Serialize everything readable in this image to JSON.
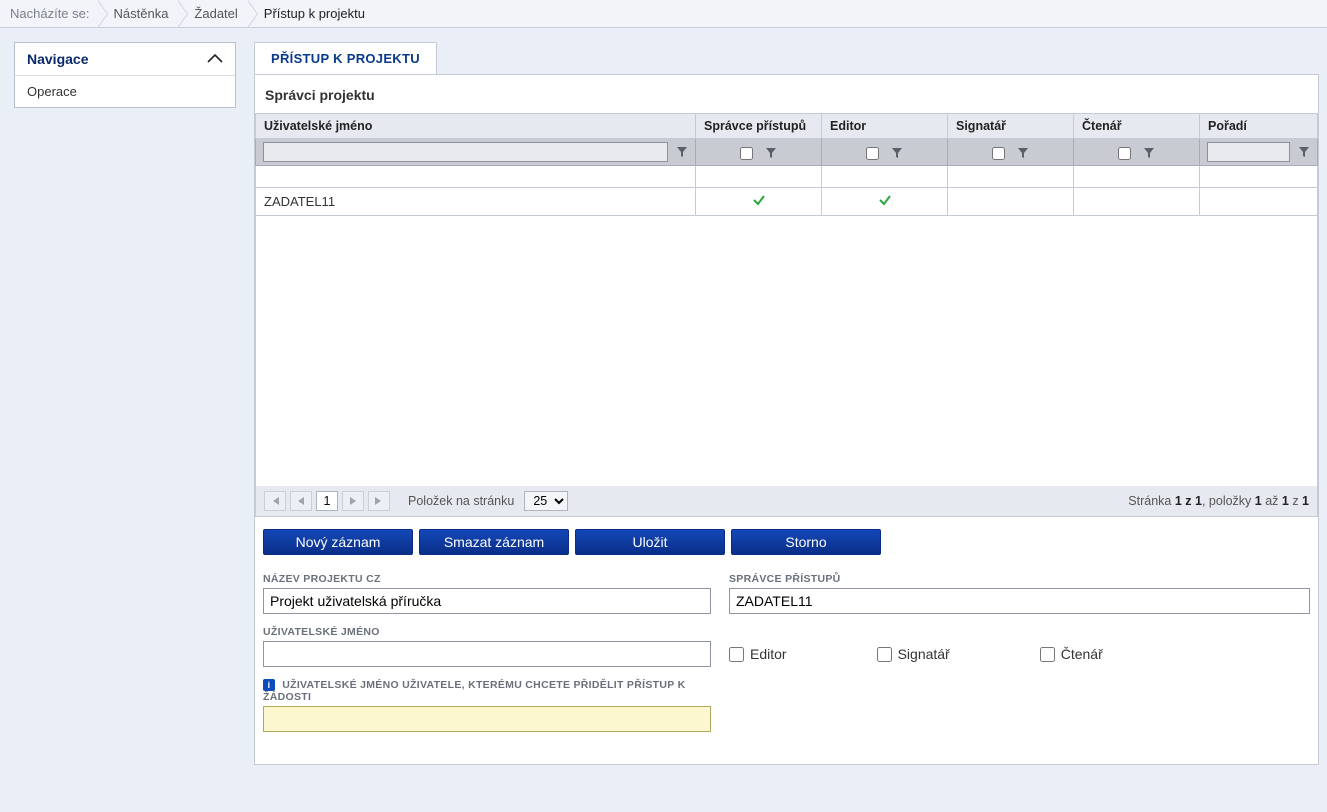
{
  "breadcrumb": {
    "label": "Nacházíte se:",
    "items": [
      "Nástěnka",
      "Žadatel",
      "Přístup k projektu"
    ]
  },
  "sidebar": {
    "nav_title": "Navigace",
    "items": [
      "Operace"
    ]
  },
  "tab": {
    "title": "PŘÍSTUP K PROJEKTU"
  },
  "grid": {
    "title": "Správci projektu",
    "columns": {
      "username": "Uživatelské jméno",
      "access_admin": "Správce přístupů",
      "editor": "Editor",
      "signatory": "Signatář",
      "reader": "Čtenář",
      "order": "Pořadí"
    },
    "rows": [
      {
        "username": "ZADATEL11",
        "access_admin": true,
        "editor": true,
        "signatory": false,
        "reader": false,
        "order": ""
      }
    ]
  },
  "pager": {
    "page": "1",
    "per_page_label": "Položek na stránku",
    "per_page_value": "25",
    "info_prefix": "Stránka ",
    "info_page": "1 z 1",
    "info_mid": ", položky ",
    "info_items_from": "1",
    "info_items_mid": " až ",
    "info_items_to": "1",
    "info_items_of": " z ",
    "info_items_total": "1"
  },
  "actions": {
    "new": "Nový záznam",
    "delete": "Smazat záznam",
    "save": "Uložit",
    "cancel": "Storno"
  },
  "form": {
    "project_name_label": "NÁZEV PROJEKTU CZ",
    "project_name_value": "Projekt uživatelská příručka",
    "access_admin_label": "SPRÁVCE PŘÍSTUPŮ",
    "access_admin_value": "ZADATEL11",
    "username_label": "UŽIVATELSKÉ JMÉNO",
    "username_value": "",
    "editor_label": "Editor",
    "signatory_label": "Signatář",
    "reader_label": "Čtenář",
    "assign_label": "UŽIVATELSKÉ JMÉNO UŽIVATELE, KTERÉMU CHCETE PŘIDĚLIT PŘÍSTUP K ŽÁDOSTI",
    "assign_value": ""
  }
}
